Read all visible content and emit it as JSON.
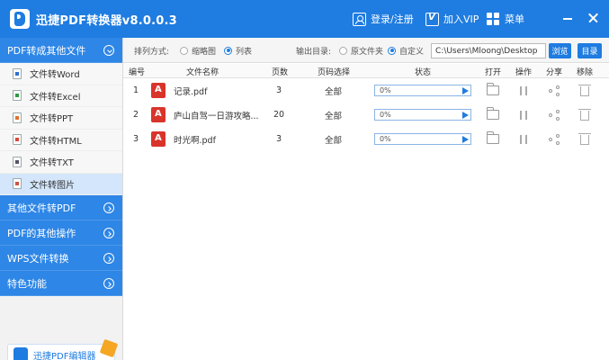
{
  "titlebar": {
    "title": "迅捷PDF转换器v8.0.0.3",
    "login_label": "登录/注册",
    "vip_label": "加入VIP",
    "menu_label": "菜单"
  },
  "sidebar": {
    "categories": [
      {
        "label": "PDF转成其他文件",
        "items": [
          {
            "label": "文件转Word",
            "icon": "word-file-icon"
          },
          {
            "label": "文件转Excel",
            "icon": "excel-file-icon"
          },
          {
            "label": "文件转PPT",
            "icon": "ppt-file-icon"
          },
          {
            "label": "文件转HTML",
            "icon": "html-file-icon"
          },
          {
            "label": "文件转TXT",
            "icon": "txt-file-icon"
          },
          {
            "label": "文件转图片",
            "icon": "image-file-icon"
          }
        ]
      },
      {
        "label": "其他文件转PDF"
      },
      {
        "label": "PDF的其他操作"
      },
      {
        "label": "WPS文件转换"
      },
      {
        "label": "特色功能"
      }
    ],
    "promo_label": "迅捷PDF编辑器"
  },
  "toolbar": {
    "sort_label": "排列方式:",
    "sort_thumb": "缩略图",
    "sort_list": "列表",
    "output_label": "输出目录:",
    "output_original": "原文件夹",
    "output_custom": "自定义",
    "output_path": "C:\\Users\\Mloong\\Desktop",
    "browse_label": "浏览",
    "directory_label": "目录"
  },
  "table": {
    "headers": {
      "index": "编号",
      "name": "文件名称",
      "pages": "页数",
      "page_select": "页码选择",
      "status": "状态",
      "open": "打开",
      "action": "操作",
      "share": "分享",
      "remove": "移除"
    },
    "rows": [
      {
        "index": "1",
        "name": "记录.pdf",
        "pages": "3",
        "page_select": "全部",
        "progress": "0%"
      },
      {
        "index": "2",
        "name": "庐山自驾一日游攻略...",
        "pages": "20",
        "page_select": "全部",
        "progress": "0%"
      },
      {
        "index": "3",
        "name": "时光啊.pdf",
        "pages": "3",
        "page_select": "全部",
        "progress": "0%"
      }
    ]
  },
  "colors": {
    "brand_blue": "#1f7ce0",
    "sidebar_category": "#2e86e6",
    "active_item": "#d3e6fb",
    "pdf_red": "#d9342b"
  }
}
